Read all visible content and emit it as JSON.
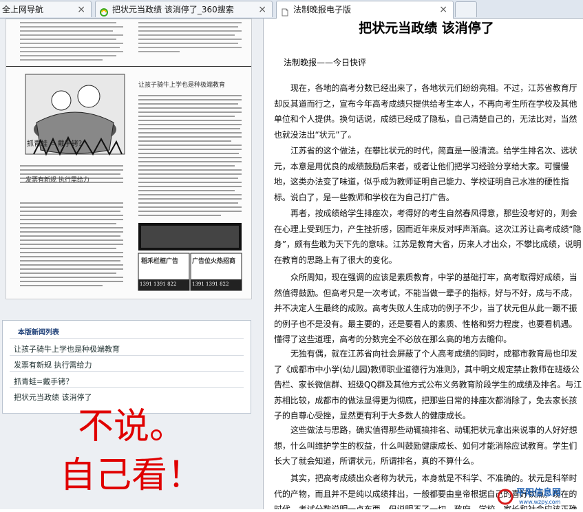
{
  "tabs": [
    {
      "label": "全上网导航",
      "close": "×"
    },
    {
      "label": "把状元当政绩  该消停了_360搜索",
      "close": "×"
    },
    {
      "label": "法制晚报电子版",
      "close": "×"
    }
  ],
  "newspaper": {
    "headline_top": "让孩子骑牛上学也是种极端教育",
    "caption_frog": "抓青蛙 = 戴手铐？",
    "headline_mid": "发票有新规 执行需给力",
    "ad1": "稻禾栏框广告",
    "ad2": "广告位火热招商",
    "ad_phone1": "1391 1391 822",
    "ad_phone2": "1391 1391 822"
  },
  "list_panel": {
    "title": "本版新闻列表",
    "items": [
      "让孩子骑牛上学也是种极端教育",
      "发票有新规  执行需给力",
      "抓青蛙=戴手铐？",
      "把状元当政绩  该消停了"
    ]
  },
  "overlay_text": {
    "line1": "不说。",
    "line2": "自己看！"
  },
  "article": {
    "title": "把状元当政绩  该消停了",
    "source": "法制晚报——今日快评",
    "paragraphs": [
      "现在，各地的高考分数已经出来了，各地状元们纷纷亮相。不过，江苏省教育厅却反其道而行之，宣布今年高考成绩只提供给考生本人，不再向考生所在学校及其他单位和个人提供。换句话说，成绩已经成了隐私，自己清楚自己的，无法比对，当然也就没法出“状元”了。",
      "江苏省的这个做法，在攀比状元的时代，简直是一股清流。给学生排名次、选状元，本意是用优良的成绩鼓励后来者，或者让他们把学习经验分享给大家。可慢慢地，这类办法变了味道，似乎成为教师证明自己能力、学校证明自己水准的硬性指标。说白了，是一些教师和学校在为自己打广告。",
      "再者，按成绩给学生排座次，考得好的考生自然春风得意，那些没考好的，则会在心理上受到压力，产生挫折感，因而近年来反对呼声渐高。这次江苏让高考成绩“隐身”，颇有些敢为天下先的意味。江苏是教育大省，历来人才出众，不攀比成绩，说明在教育的思路上有了很大的变化。",
      "众所周知，现在强调的应该是素质教育，中学的基础打牢，高考取得好成绩，当然值得鼓励。但高考只是一次考试，不能当做一辈子的指标，好与不好，成与不成，并不决定人生最终的成败。高考失败人生成功的例子不少，当了状元但从此一蹶不振的例子也不是没有。最主要的，还是要看人的素质、性格和努力程度，也要看机遇。懂得了这些道理，高考的分数完全不必放在那么高的地方去瞻仰。",
      "无独有偶，就在江苏省向社会屏蔽了个人高考成绩的同时，成都市教育局也印发了《成都市中小学(幼儿园)教师职业道德行为准则》，其中明文规定禁止教师在班级公告栏、家长微信群、班级QQ群及其他方式公布义务教育阶段学生的成绩及排名。与江苏相比较，成都市的做法显得更为彻底，把那些日常的排座次都消除了，免去家长孩子的自尊心受挫，显然更有利于大多数人的健康成长。",
      "这些做法与思路，确实值得那些动辄搞排名、动辄把状元拿出来说事的人好好想想，什么叫维护学生的权益，什么叫鼓励健康成长、如何才能消除应试教育。学生们长大了就会知道，所谓状元，所谓排名，真的不算什么。",
      "其实，把高考成绩出众者称为状元，本身就是不科学、不准确的。状元是科举时代的产物，而且并不是纯以成绩排出，一般都要由皇帝根据自己的喜好钦点。现在的时代，考试分数说明一点东西，但说明不了一切，政府、学校、家长和社会应该正确认识，所以炒作一阵状元"
    ]
  },
  "watermark": {
    "text": "平阳信息网",
    "url": "www.wzpy.com"
  }
}
